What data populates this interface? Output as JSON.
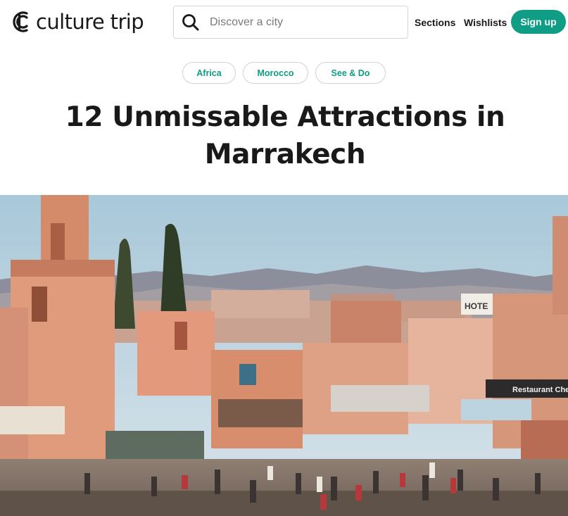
{
  "header": {
    "logo_text": "culture trip",
    "search": {
      "placeholder": "Discover a city",
      "value": ""
    },
    "nav": {
      "sections": "Sections",
      "wishlists": "Wishlists"
    },
    "signup": "Sign up"
  },
  "tags": [
    {
      "label": "Africa"
    },
    {
      "label": "Morocco"
    },
    {
      "label": "See & Do"
    }
  ],
  "article": {
    "title_line1": "12 Unmissable Attractions in",
    "title_line2": "Marrakech"
  },
  "hero": {
    "signs": {
      "hotel": "HOTE",
      "restaurant": "Restaurant Che"
    }
  },
  "colors": {
    "accent": "#109d86",
    "tag_text": "#119b82",
    "text": "#191919"
  },
  "icons": {
    "logo": "culture-trip-logo-mark",
    "search": "search-icon"
  }
}
